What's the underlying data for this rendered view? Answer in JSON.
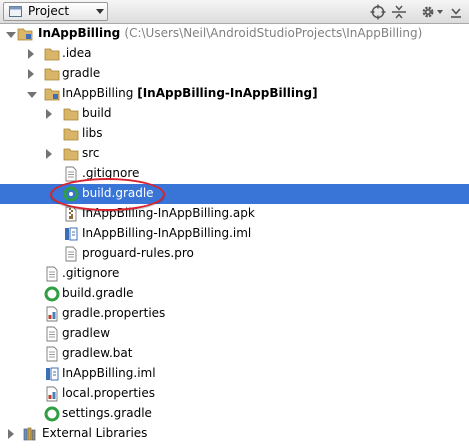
{
  "toolbar": {
    "view_selector": "Project",
    "icons": [
      "scroll-from-source-icon",
      "collapse-all-icon",
      "settings-gear-icon",
      "hide-panel-icon"
    ]
  },
  "tree": {
    "root_name": "InAppBilling",
    "root_path": "(C:\\Users\\Neil\\AndroidStudioProjects\\InAppBilling)",
    "idea": ".idea",
    "gradle_folder": "gradle",
    "module_name": "InAppBilling",
    "module_tag": "[InAppBilling-InAppBilling]",
    "build": "build",
    "libs": "libs",
    "src": "src",
    "module_gitignore": ".gitignore",
    "module_build_gradle": "build.gradle",
    "apk": "InAppBilling-InAppBilling.apk",
    "module_iml": "InAppBilling-InAppBilling.iml",
    "proguard": "proguard-rules.pro",
    "root_gitignore": ".gitignore",
    "root_build_gradle": "build.gradle",
    "gradle_properties": "gradle.properties",
    "gradlew": "gradlew",
    "gradlew_bat": "gradlew.bat",
    "root_iml": "InAppBilling.iml",
    "local_properties": "local.properties",
    "settings_gradle": "settings.gradle",
    "external_libraries": "External Libraries"
  },
  "selected_item": "build.gradle",
  "colors": {
    "selection": "#3875d7",
    "folder": "#d9b56a",
    "gradle": "#2f9e44",
    "highlight_ring": "#d9232e",
    "path_text": "#808080"
  }
}
